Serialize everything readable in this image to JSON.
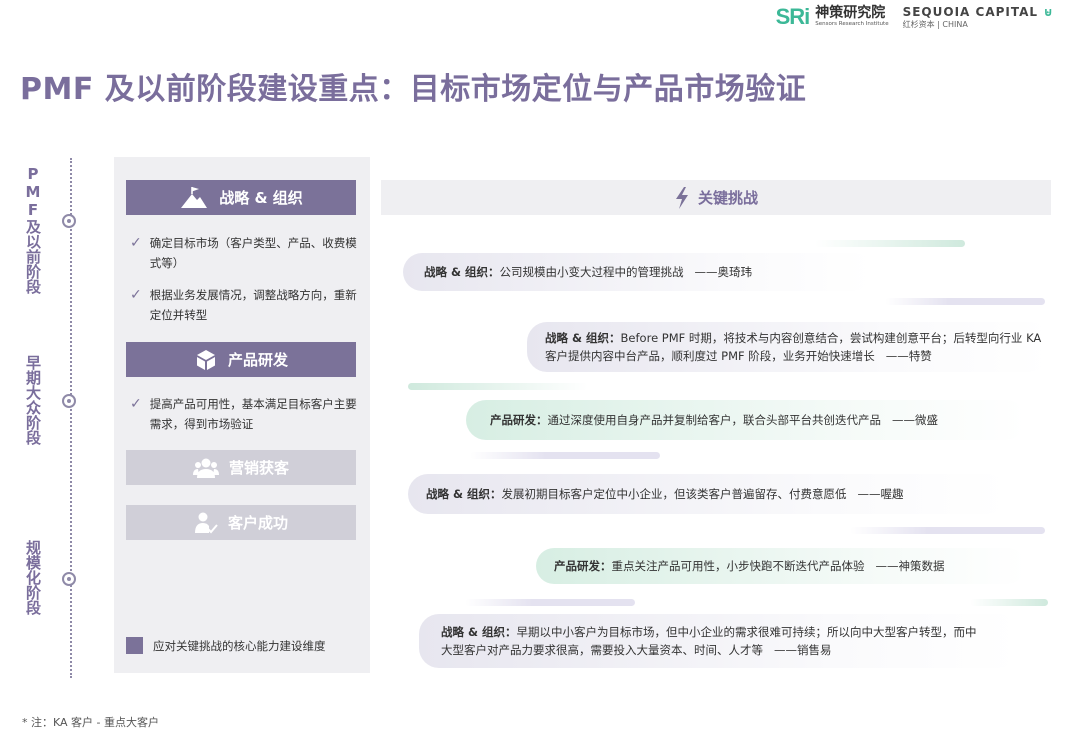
{
  "header": {
    "sri_mark": "SRi",
    "sri_name_cn": "神策研究院",
    "sri_name_en": "Sensors Research Institute",
    "sequoia_name": "SEQUOIA CAPITAL",
    "sequoia_sub": "红杉资本 | CHINA"
  },
  "title": "PMF 及以前阶段建设重点：目标市场定位与产品市场验证",
  "stages": [
    {
      "label": "PMF及以前阶段"
    },
    {
      "label": "早期大众阶段"
    },
    {
      "label": "规模化阶段"
    }
  ],
  "capabilities": [
    {
      "name": "战略 & 组织",
      "icon": "mountain-flag-icon",
      "active": true,
      "bullets": [
        "确定目标市场（客户类型、产品、收费模式等）",
        "根据业务发展情况，调整战略方向，重新定位并转型"
      ]
    },
    {
      "name": "产品研发",
      "icon": "cube-icon",
      "active": true,
      "bullets": [
        "提高产品可用性，基本满足目标客户主要需求，得到市场验证"
      ]
    },
    {
      "name": "营销获客",
      "icon": "users-icon",
      "active": false,
      "bullets": []
    },
    {
      "name": "客户成功",
      "icon": "user-check-icon",
      "active": false,
      "bullets": []
    }
  ],
  "legend": "应对关键挑战的核心能力建设维度",
  "challenge_title": "关键挑战",
  "challenges": [
    {
      "category": "战略 & 组织：",
      "text": "公司规模由小变大过程中的管理挑战",
      "source": "——奥琦玮"
    },
    {
      "category": "战略 & 组织：",
      "text": "Before PMF 时期，将技术与内容创意结合，尝试构建创意平台；后转型向行业 KA 客户提供内容中台产品，顺利度过 PMF 阶段，业务开始快速增长",
      "source": "——特赞"
    },
    {
      "category": "产品研发：",
      "text": "通过深度使用自身产品并复制给客户，联合头部平台共创迭代产品",
      "source": "——微盛"
    },
    {
      "category": "战略 & 组织：",
      "text": "发展初期目标客户定位中小企业，但该类客户普遍留存、付费意愿低",
      "source": "——喔趣"
    },
    {
      "category": "产品研发：",
      "text": "重点关注产品可用性，小步快跑不断迭代产品体验",
      "source": "——神策数据"
    },
    {
      "category": "战略 & 组织：",
      "text": "早期以中小客户为目标市场，但中小企业的需求很难可持续；所以向中大型客户转型，而中大型客户对产品力要求很高，需要投入大量资本、时间、人才等",
      "source": "——销售易"
    }
  ],
  "footnote": "* 注：KA 客户 - 重点大客户"
}
